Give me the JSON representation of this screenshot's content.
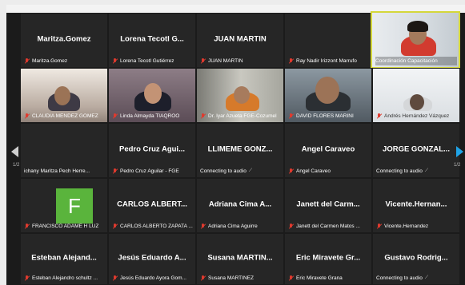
{
  "pagination": {
    "left_label": "1/2",
    "right_label": "1/2"
  },
  "tiles": [
    {
      "name": "Maritza.Gomez",
      "label": "Maritza.Gomez"
    },
    {
      "name": "Lorena Tecotl G...",
      "label": "Lorena Tecotl Gutiérrez"
    },
    {
      "name": "JUAN MARTIN",
      "label": "JUAN MARTIN"
    },
    {
      "name": "",
      "label": "Ray Nadir Irizzont Marrufo"
    },
    {
      "name": "",
      "label": "Coordinación Capacitación"
    },
    {
      "name": "",
      "label": "CLAUDIA MENDEZ GOMEZ"
    },
    {
      "name": "",
      "label": "Linda Almayda TIAQROO"
    },
    {
      "name": "",
      "label": "Dr. Iyar Azueta FGE-Cozumel"
    },
    {
      "name": "",
      "label": "DAVID FLORES MARINI"
    },
    {
      "name": "",
      "label": "Andrés Hernández Vázquez"
    },
    {
      "name": "",
      "label": "ichany Maritza Pech Herre..."
    },
    {
      "name": "Pedro Cruz Agui...",
      "label": "Pedro Cruz Aguilar - FGE"
    },
    {
      "name": "LLIMEME GONZ...",
      "label": "Connecting to audio"
    },
    {
      "name": "Angel Caraveo",
      "label": "Angel Caraveo"
    },
    {
      "name": "JORGE GONZAL...",
      "label": "Connecting to audio"
    },
    {
      "name": "",
      "label": "FRANCISCO ADAME H LUZ",
      "avatar_letter": "F"
    },
    {
      "name": "CARLOS ALBERT...",
      "label": "CARLOS ALBERTO ZAPATA ..."
    },
    {
      "name": "Adriana Cima A...",
      "label": "Adriana Cima Aguirre"
    },
    {
      "name": "Janett del Carm...",
      "label": "Janett del Carmen Matos ..."
    },
    {
      "name": "Vicente.Hernan...",
      "label": "Vicente.Hernandez"
    },
    {
      "name": "Esteban Alejand...",
      "label": "Esteban Alejandro schultz ..."
    },
    {
      "name": "Jesús Eduardo A...",
      "label": "Jesús Eduardo Ayora Gom..."
    },
    {
      "name": "Susana MARTIN...",
      "label": "Susana MARTINEZ"
    },
    {
      "name": "Eric Miravete Gr...",
      "label": "Eric Miravete Grana"
    },
    {
      "name": "Gustavo Rodrig...",
      "label": "Connecting to audio"
    }
  ]
}
